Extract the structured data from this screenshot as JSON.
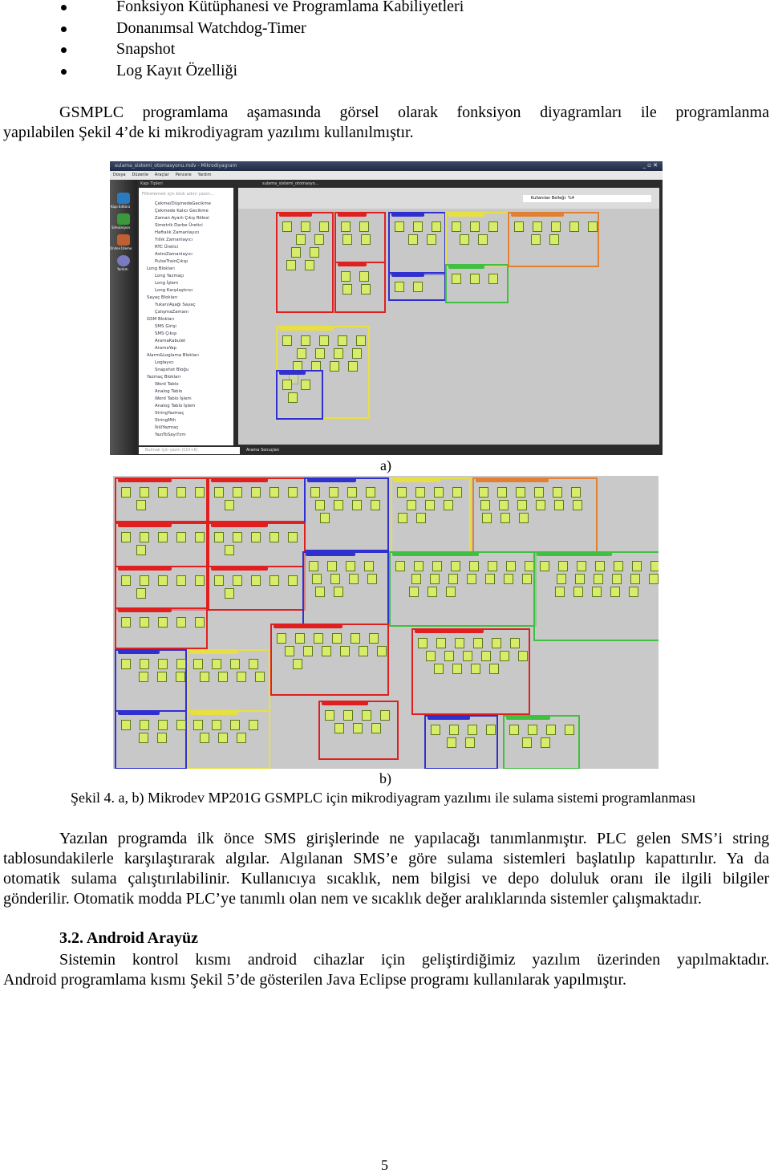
{
  "bullets": [
    "Fonksiyon Kütüphanesi ve Programlama Kabiliyetleri",
    "Donanımsal Watchdog-Timer",
    "Snapshot",
    "Log Kayıt Özelliği"
  ],
  "para1": [
    "GSMPLC programlama aşamasında görsel olarak fonksiyon diyagramları ile programlanma",
    "yapılabilen Şekil 4’de ki mikrodiyagram yazılımı kullanılmıştır."
  ],
  "figure_a": {
    "window_title": "sulama_sistemi_otomasyonu.mdv - Mikrodiyagram",
    "menu": [
      "Dosya",
      "Düzenle",
      "Araçlar",
      "Pencere",
      "Yardım"
    ],
    "panel_title": "Kapı Tipleri",
    "tab": "sulama_sistemi_otomasyo...",
    "search_placeholder": "Filtrelemek için blok adını yazın...",
    "side_tools": [
      "Kapı Editörü",
      "Simulasyon",
      "Online İzleme",
      "Yardım"
    ],
    "tree": [
      "Çekme/DüşmedeGecikme",
      "Çekmede Kalıcı Gecikme",
      "Zaman Ayarlı Çıkış Rölesi",
      "Simetrik Darbe Üretici",
      "Haftalık Zamanlayıcı",
      "Yıllık Zamanlayıcı",
      "RTC Üretici",
      "AstroZamanlayıcı",
      "PulseTrainÇıkışı",
      "Long Blokları",
      "Long Yazmaçı",
      "Long İşlem",
      "Long Karşılaştırıcı",
      "Sayaç Blokları",
      "Yukarı/Aşağı Sayaç",
      "ÇalışmaZamanı",
      "GSM Blokları",
      "SMS Girişi",
      "SMS Çıkışı",
      "AramaKabulet",
      "AramaYap",
      "Alarm&Loglama Blokları",
      "Loglayıcı",
      "Snapshot Bloğu",
      "Yazmaç Blokları",
      "Word Tablo",
      "Analog Tablo",
      "Word Tablo İşlem",
      "Analog Tablo İşlem",
      "StringYazmaç",
      "StringMth",
      "İkiliYazmaç",
      "YazıToSayıYzm"
    ],
    "memory": "Kullanılan Belleği: %4",
    "bottom_search": "Bulmak için yazın (Ctrl+K)",
    "bottom_tab": "Arama Sonuçları",
    "label": "a)"
  },
  "figure_b": {
    "label": "b)"
  },
  "caption": "Şekil 4. a, b) Mikrodev MP201G GSMPLC için mikrodiyagram yazılımı ile sulama sistemi programlanması",
  "para2": [
    "Yazılan programda ilk önce SMS girişlerinde ne yapılacağı tanımlanmıştır. PLC gelen SMS’i string",
    "tablosundakilerle karşılaştırarak algılar. Algılanan SMS’e göre sulama sistemleri başlatılıp kapattırılır. Ya da",
    "otomatik sulama çalıştırılabilinir. Kullanıcıya sıcaklık, nem bilgisi ve depo doluluk oranı ile ilgili bilgiler",
    "gönderilir. Otomatik modda PLC’ye tanımlı olan nem ve sıcaklık değer aralıklarında sistemler çalışmaktadır."
  ],
  "heading": "3.2. Android Arayüz",
  "para3": [
    "Sistemin kontrol kısmı android cihazlar için geliştirdiğimiz yazılım üzerinden yapılmaktadır.",
    "Android programlama kısmı Şekil 5’de gösterilen Java Eclipse programı kullanılarak yapılmıştır."
  ],
  "page_number": "5",
  "colors": {
    "red": "#e02020",
    "blue": "#3030d0",
    "yellow": "#e8e040",
    "green": "#40c040",
    "orange": "#e08030",
    "block": "#d8ec6a"
  }
}
